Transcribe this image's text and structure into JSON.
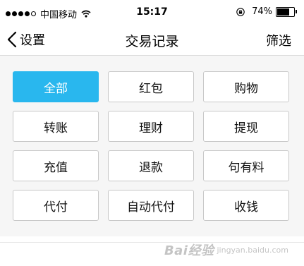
{
  "status_bar": {
    "carrier": "中国移动",
    "time": "15:17",
    "battery_percent": "74%",
    "battery_level": 0.74,
    "signal_bars": 4,
    "icons": [
      "signal-dots-icon",
      "wifi-icon",
      "orientation-lock-icon",
      "battery-icon"
    ]
  },
  "nav": {
    "back_label": "设置",
    "title": "交易记录",
    "filter_label": "筛选",
    "back_icon": "chevron-left-icon"
  },
  "options": {
    "selected_index": 0,
    "selected_color": "#29b7ee",
    "items": [
      {
        "label": "全部"
      },
      {
        "label": "红包"
      },
      {
        "label": "购物"
      },
      {
        "label": "转账"
      },
      {
        "label": "理财"
      },
      {
        "label": "提现"
      },
      {
        "label": "充值"
      },
      {
        "label": "退款"
      },
      {
        "label": "句有料"
      },
      {
        "label": "代付"
      },
      {
        "label": "自动代付"
      },
      {
        "label": "收钱"
      }
    ]
  },
  "watermark": {
    "text": "Bai经验",
    "sub": "jingyan.baidu.com"
  }
}
